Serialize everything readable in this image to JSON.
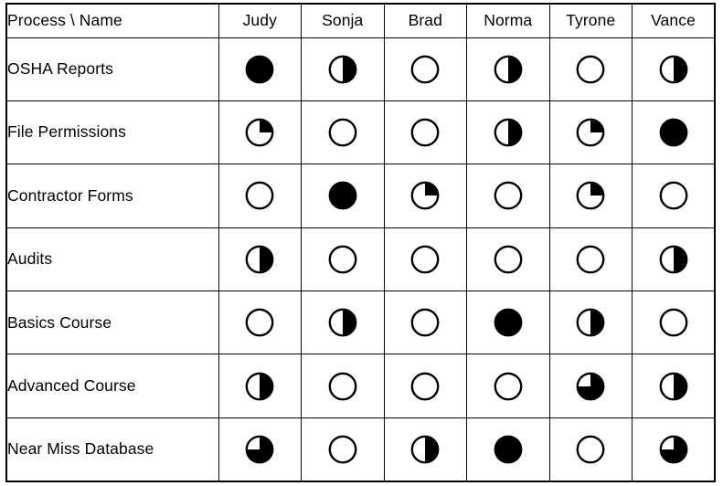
{
  "table": {
    "corner_label": "Process \\ Name",
    "columns": [
      "Judy",
      "Sonja",
      "Brad",
      "Norma",
      "Tyrone",
      "Vance"
    ],
    "rows": [
      {
        "label": "OSHA Reports",
        "values": [
          "full",
          "half",
          "empty",
          "half",
          "empty",
          "half"
        ]
      },
      {
        "label": "File Permissions",
        "values": [
          "quarter",
          "empty",
          "empty",
          "half",
          "quarter",
          "full"
        ]
      },
      {
        "label": "Contractor Forms",
        "values": [
          "empty",
          "full",
          "quarter",
          "empty",
          "quarter",
          "empty"
        ]
      },
      {
        "label": "Audits",
        "values": [
          "half",
          "empty",
          "empty",
          "empty",
          "empty",
          "half"
        ]
      },
      {
        "label": "Basics Course",
        "values": [
          "empty",
          "half",
          "empty",
          "full",
          "half",
          "empty"
        ]
      },
      {
        "label": "Advanced Course",
        "values": [
          "half",
          "empty",
          "empty",
          "empty",
          "three_quarter",
          "half"
        ]
      },
      {
        "label": "Near Miss Database",
        "values": [
          "three_quarter",
          "empty",
          "half",
          "full",
          "empty",
          "three_quarter"
        ]
      }
    ],
    "symbol_legend": {
      "empty": "empty-circle",
      "quarter": "quarter-filled-circle",
      "half": "half-filled-circle",
      "three_quarter": "three-quarter-filled-circle",
      "full": "full-filled-circle"
    },
    "colors": {
      "fill": "#000000",
      "stroke": "#000000",
      "background": "#ffffff",
      "border": "#000000"
    }
  }
}
